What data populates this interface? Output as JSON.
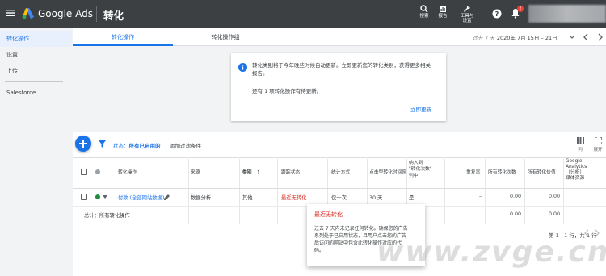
{
  "topbar": {
    "brand": "Google Ads",
    "page_title": "转化",
    "search_label": "搜索",
    "reports_label": "报告",
    "tools_label_1": "工具与",
    "tools_label_2": "设置",
    "notification_count": "!"
  },
  "leftnav": {
    "items": [
      {
        "label": "转化操作",
        "active": true
      },
      {
        "label": "设置"
      },
      {
        "label": "上传"
      },
      {
        "label": "Salesforce"
      }
    ]
  },
  "tabs": [
    {
      "label": "转化操作",
      "active": true
    },
    {
      "label": "转化操作组"
    }
  ],
  "daterange": {
    "preset": "过去 7 天",
    "range": "2020年 7月 15日 – 21日"
  },
  "notice": {
    "line1": "转化类别将于今年晚些时候自动更新。立即更新您的转化类别，获得更多相关",
    "line2": "报告。",
    "pending": "还有 1 项转化操作有待更新。",
    "action": "立即更新"
  },
  "filterbar": {
    "status_label": "状态：",
    "status_value": "所有已启用的",
    "add_filter": "添加过滤条件",
    "columns_label": "列",
    "expand_label": "展开"
  },
  "table": {
    "headers": {
      "conversion_action": "转化操作",
      "source": "来源",
      "category": "类别",
      "tracking_status": "跟踪状态",
      "count": "统计方式",
      "ctc_window": "点击型转化时间窗",
      "include_1": "纳入到",
      "include_2": "\"转化次数\"",
      "include_3": "列中",
      "repeat_rate": "重复率",
      "all_conv": "所有转化次数",
      "all_conv_value": "所有转化价值",
      "ga_1": "Google",
      "ga_2": "Analytics",
      "ga_3": "（分析）",
      "ga_4": "媒体资源"
    },
    "rows": [
      {
        "name": "付款 (全部网站数据)",
        "source": "数据分析",
        "category": "其他",
        "status": "最近无转化",
        "count": "仅一次",
        "window": "30 天",
        "include": "是",
        "repeat": "–",
        "all_conv": "0.00",
        "all_value": "0.00",
        "ga": ""
      }
    ],
    "total": {
      "label": "总计：所有转化操作",
      "all_conv": "0.00",
      "all_value": "0.00"
    },
    "pager": "第 1 - 1 行，共 1 行"
  },
  "tooltip": {
    "title": "最近无转化",
    "body_1": "过去 7 天内未记录任何转化。确保您的广告",
    "body_2": "系列处于已启用状态，且用户点击您的广告",
    "body_3": "后访问的网站中包含此转化操作对应的代",
    "body_4": "码。"
  },
  "watermark": "www.zvge.cn",
  "colors": {
    "topbar": "#3c4043",
    "accent": "#1a73e8",
    "error": "#d93025",
    "status_green": "#1e8e3e"
  }
}
